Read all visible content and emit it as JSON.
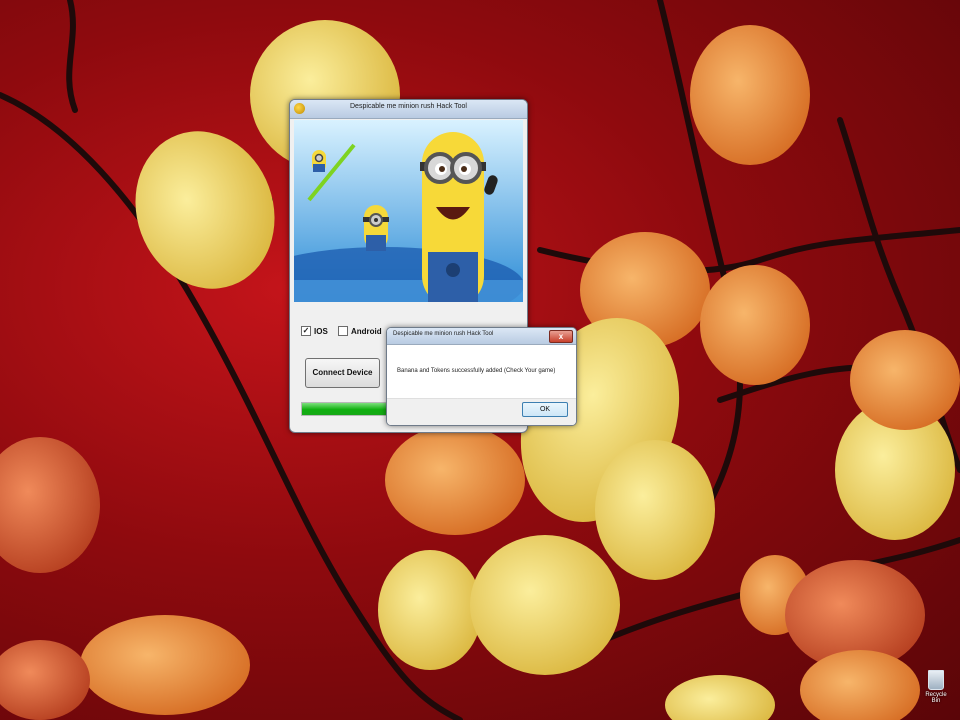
{
  "main_window": {
    "title": "Despicable me minion rush Hack Tool",
    "options": [
      {
        "label": "IOS",
        "checked": true
      },
      {
        "label": "Android",
        "checked": false
      }
    ],
    "connect_label": "Connect Device",
    "progress": 0.45
  },
  "message_box": {
    "title": "Despicable me minion rush Hack Tool",
    "message": "Banana and Tokens successfully added (Check Your game)",
    "ok_label": "OK",
    "close_label": "x"
  },
  "desktop": {
    "recycle_label": "Recycle Bin"
  },
  "colors": {
    "wallpaper_red": "#b0121a",
    "leaf_yellow": "#f0d45a",
    "leaf_orange": "#e88a3a",
    "progress_green": "#16a816"
  }
}
